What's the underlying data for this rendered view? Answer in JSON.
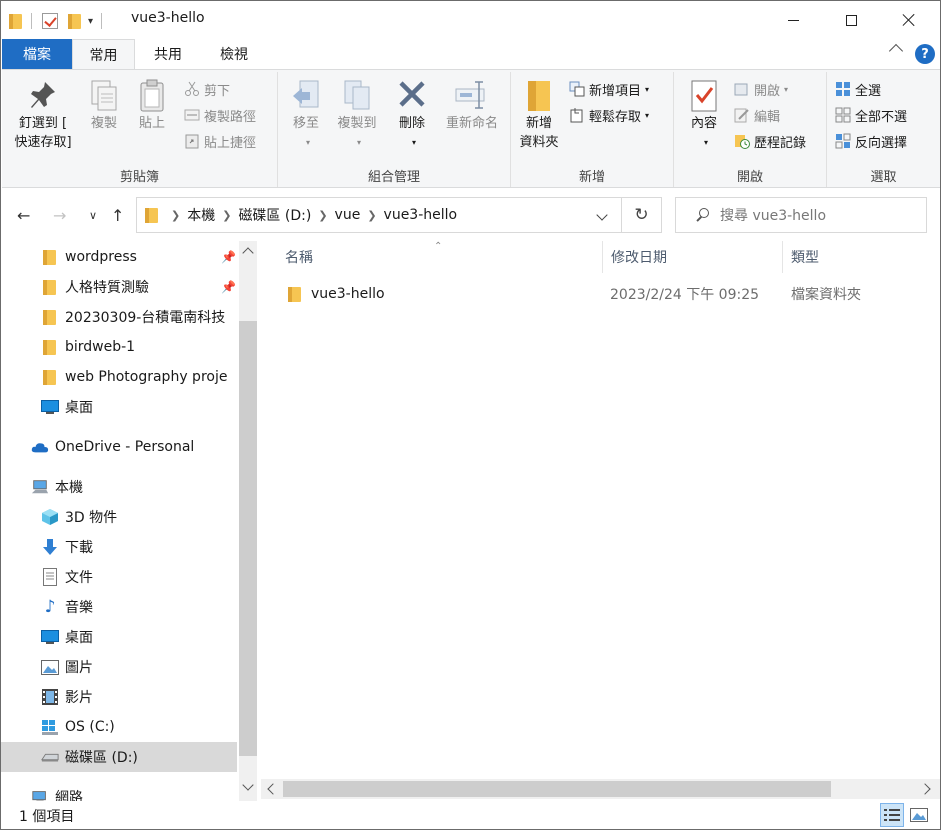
{
  "window": {
    "title": "vue3-hello",
    "qat_dropdown": "▾"
  },
  "tabs": {
    "file": "檔案",
    "home": "常用",
    "share": "共用",
    "view": "檢視",
    "help": "?"
  },
  "ribbon": {
    "clipboard": {
      "label": "剪貼簿",
      "pin_line1": "釘選到 [",
      "pin_line2": "快速存取]",
      "copy": "複製",
      "paste": "貼上",
      "cut": "剪下",
      "copy_path": "複製路徑",
      "paste_shortcut": "貼上捷徑"
    },
    "organize": {
      "label": "組合管理",
      "move_to": "移至",
      "copy_to": "複製到",
      "delete": "刪除",
      "rename": "重新命名"
    },
    "new": {
      "label": "新增",
      "new_folder_line1": "新增",
      "new_folder_line2": "資料夾",
      "new_item": "新增項目",
      "easy_access": "輕鬆存取"
    },
    "open": {
      "label": "開啟",
      "properties": "內容",
      "open": "開啟",
      "edit": "編輯",
      "history": "歷程記錄"
    },
    "select": {
      "label": "選取",
      "select_all": "全選",
      "select_none": "全部不選",
      "invert": "反向選擇"
    }
  },
  "address": {
    "crumbs": [
      "本機",
      "磁碟區 (D:)",
      "vue",
      "vue3-hello"
    ],
    "search_placeholder": "搜尋 vue3-hello"
  },
  "navpane": {
    "quick_access": [
      {
        "label": "wordpress",
        "pinned": true
      },
      {
        "label": "人格特質測驗",
        "pinned": true
      },
      {
        "label": "20230309-台積電南科技"
      },
      {
        "label": "birdweb-1"
      },
      {
        "label": "web Photography proje"
      },
      {
        "label": "桌面"
      }
    ],
    "onedrive": "OneDrive - Personal",
    "this_pc": "本機",
    "pc_items": [
      "3D 物件",
      "下載",
      "文件",
      "音樂",
      "桌面",
      "圖片",
      "影片",
      "OS (C:)",
      "磁碟區 (D:)"
    ],
    "network": "網路"
  },
  "columns": {
    "name": "名稱",
    "date": "修改日期",
    "type": "類型"
  },
  "files": [
    {
      "name": "vue3-hello",
      "date": "2023/2/24 下午 09:25",
      "type": "檔案資料夾"
    }
  ],
  "status": {
    "count": "1 個項目"
  },
  "colors": {
    "accent": "#1f6dc4",
    "folder": "#f6c552",
    "selection": "#d9d9d9"
  }
}
